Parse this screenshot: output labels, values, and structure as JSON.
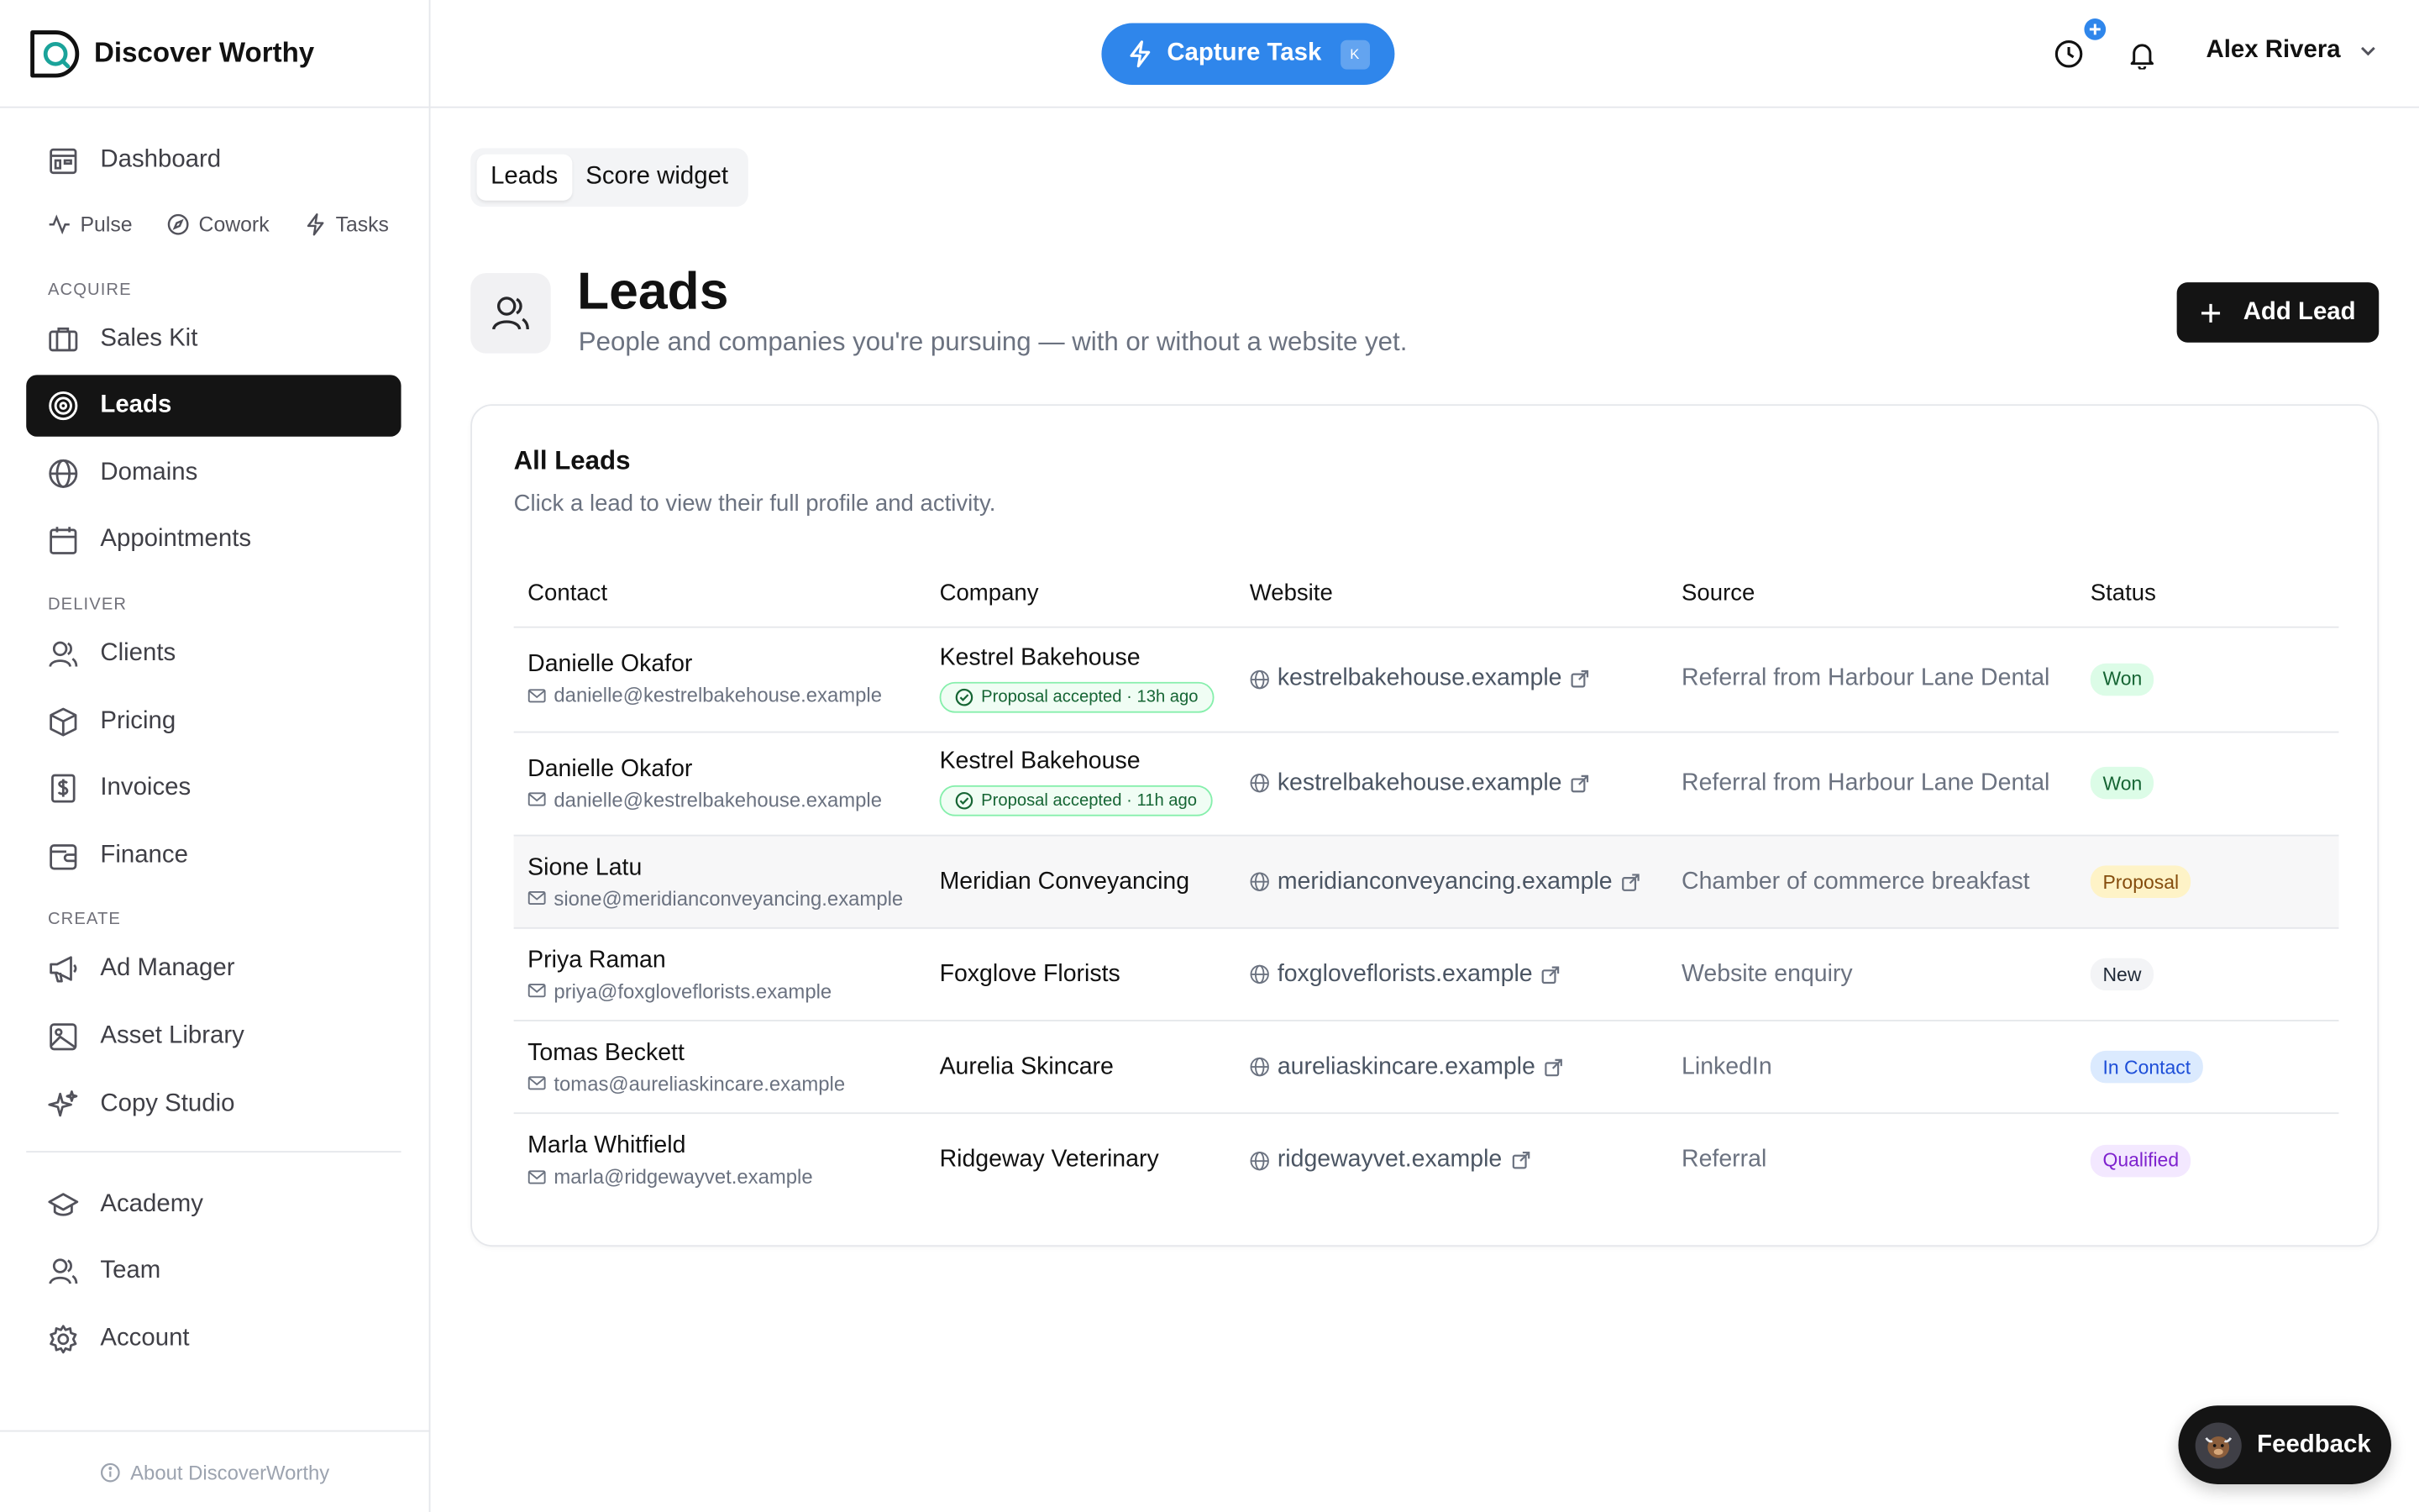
{
  "brand": {
    "name": "Discover Worthy"
  },
  "header": {
    "capture_label": "Capture Task",
    "capture_shortcut": "K",
    "user_name": "Alex Rivera"
  },
  "sidebar": {
    "dashboard": "Dashboard",
    "sub_links": [
      "Pulse",
      "Cowork",
      "Tasks"
    ],
    "sections": {
      "acquire": "ACQUIRE",
      "deliver": "DELIVER",
      "create": "CREATE"
    },
    "acquire_items": [
      "Sales Kit",
      "Leads",
      "Domains",
      "Appointments"
    ],
    "deliver_items": [
      "Clients",
      "Pricing",
      "Invoices",
      "Finance"
    ],
    "create_items": [
      "Ad Manager",
      "Asset Library",
      "Copy Studio"
    ],
    "bottom_items": [
      "Academy",
      "Team",
      "Account"
    ],
    "active_item": "Leads",
    "footer": "About DiscoverWorthy"
  },
  "tabs": [
    "Leads",
    "Score widget"
  ],
  "page": {
    "title": "Leads",
    "subtitle": "People and companies you're pursuing — with or without a website yet.",
    "add_button": "Add Lead"
  },
  "card": {
    "title": "All Leads",
    "subtitle": "Click a lead to view their full profile and activity."
  },
  "table": {
    "columns": [
      "Contact",
      "Company",
      "Website",
      "Source",
      "Status"
    ],
    "rows": [
      {
        "name": "Danielle Okafor",
        "email": "danielle@kestrelbakehouse.example",
        "company": "Kestrel Bakehouse",
        "badge": "Proposal accepted · 13h ago",
        "website": "kestrelbakehouse.example",
        "source": "Referral from Harbour Lane Dental",
        "status": "Won"
      },
      {
        "name": "Danielle Okafor",
        "email": "danielle@kestrelbakehouse.example",
        "company": "Kestrel Bakehouse",
        "badge": "Proposal accepted · 11h ago",
        "website": "kestrelbakehouse.example",
        "source": "Referral from Harbour Lane Dental",
        "status": "Won"
      },
      {
        "name": "Sione Latu",
        "email": "sione@meridianconveyancing.example",
        "company": "Meridian Conveyancing",
        "badge": "",
        "website": "meridianconveyancing.example",
        "source": "Chamber of commerce breakfast",
        "status": "Proposal"
      },
      {
        "name": "Priya Raman",
        "email": "priya@foxgloveflorists.example",
        "company": "Foxglove Florists",
        "badge": "",
        "website": "foxgloveflorists.example",
        "source": "Website enquiry",
        "status": "New"
      },
      {
        "name": "Tomas Beckett",
        "email": "tomas@aureliaskincare.example",
        "company": "Aurelia Skincare",
        "badge": "",
        "website": "aureliaskincare.example",
        "source": "LinkedIn",
        "status": "In Contact"
      },
      {
        "name": "Marla Whitfield",
        "email": "marla@ridgewayvet.example",
        "company": "Ridgeway Veterinary",
        "badge": "",
        "website": "ridgewayvet.example",
        "source": "Referral",
        "status": "Qualified"
      }
    ]
  },
  "feedback": {
    "label": "Feedback"
  },
  "colors": {
    "accent_blue": "#2f86eb",
    "active_nav": "#141414",
    "won": "#166534",
    "proposal": "#854d0e",
    "in_contact": "#1d4ed8",
    "qualified": "#7e22ce"
  }
}
